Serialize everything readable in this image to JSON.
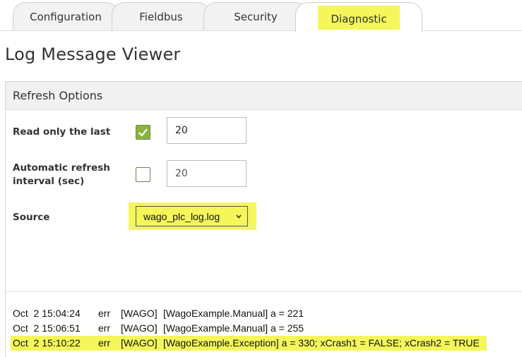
{
  "tabs": [
    {
      "label": "Configuration"
    },
    {
      "label": "Fieldbus"
    },
    {
      "label": "Security"
    },
    {
      "label": "Diagnostic",
      "active": true
    }
  ],
  "page_title": "Log Message Viewer",
  "refresh_options": {
    "title": "Refresh Options",
    "read_only_last": {
      "label": "Read only the last",
      "checked": true,
      "value": "20"
    },
    "auto_refresh": {
      "label": "Automatic refresh interval (sec)",
      "checked": false,
      "value": "20"
    },
    "source": {
      "label": "Source",
      "selected": "wago_plc_log.log"
    }
  },
  "log_lines": [
    {
      "timestamp": "Oct  2 15:04:24",
      "level": "err",
      "source": "[WAGO]",
      "message": "[WagoExample.Manual] a = 221"
    },
    {
      "timestamp": "Oct  2 15:06:51",
      "level": "err",
      "source": "[WAGO]",
      "message": "[WagoExample.Manual] a = 255"
    },
    {
      "timestamp": "Oct  2 15:10:22",
      "level": "err",
      "source": "[WAGO]",
      "message": "[WagoExample.Exception] a = 330; xCrash1 = FALSE; xCrash2 = TRUE",
      "highlighted": true
    }
  ],
  "colors": {
    "highlight": "#f4f65a",
    "checkbox_green": "#8bb33f"
  }
}
